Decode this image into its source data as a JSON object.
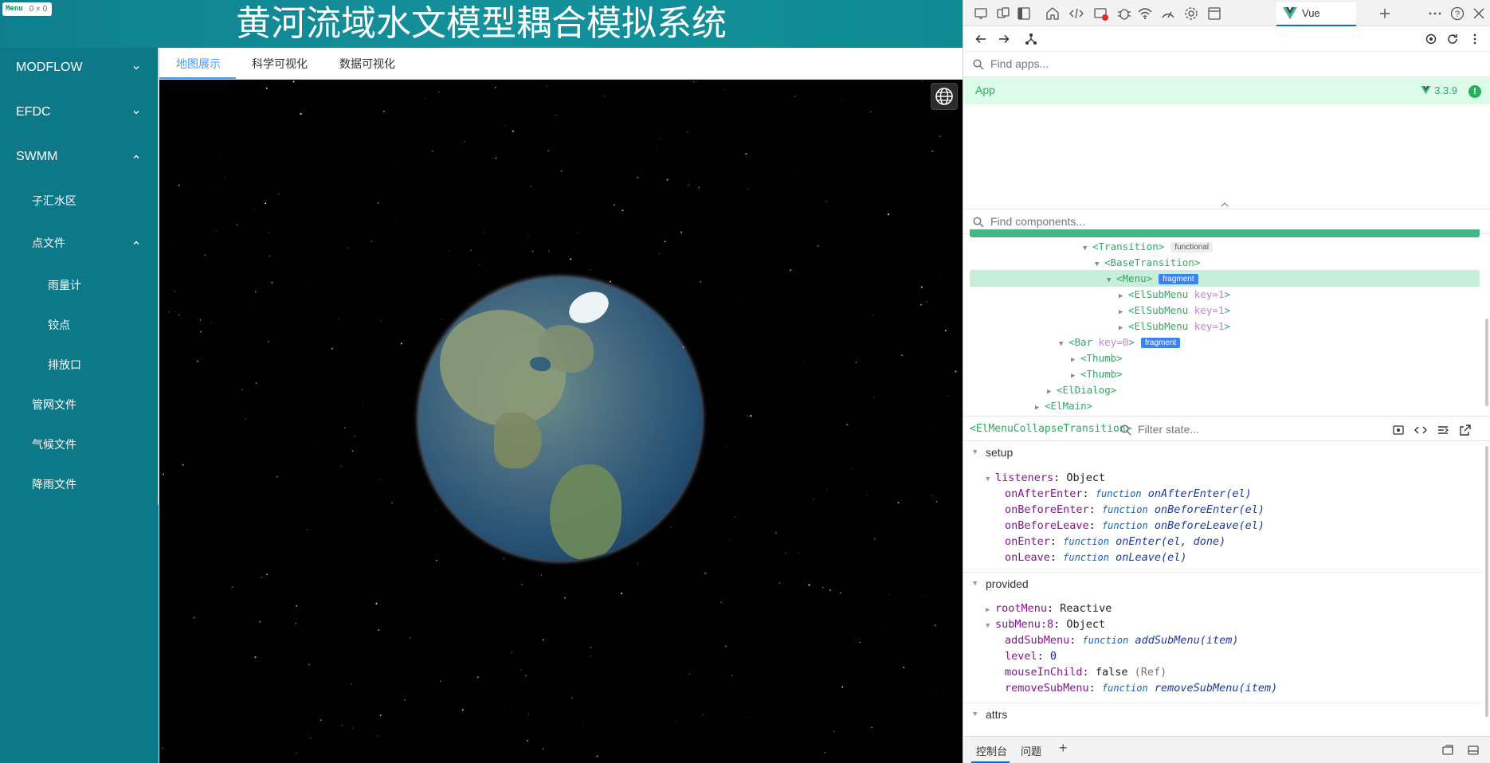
{
  "app": {
    "title": "黄河流域水文模型耦合模拟系统",
    "devtools_chip": {
      "tag": "Menu",
      "size": "0 × 0"
    },
    "sidebar": {
      "items": [
        {
          "label": "MODFLOW",
          "chevron": "down"
        },
        {
          "label": "EFDC",
          "chevron": "down"
        },
        {
          "label": "SWMM",
          "chevron": "up"
        },
        {
          "label": "子汇水区"
        },
        {
          "label": "点文件",
          "chevron": "up"
        },
        {
          "label": "雨量计"
        },
        {
          "label": "铰点"
        },
        {
          "label": "排放口"
        },
        {
          "label": "管网文件"
        },
        {
          "label": "气候文件"
        },
        {
          "label": "降雨文件"
        }
      ]
    },
    "tabs": [
      {
        "label": "地图展示",
        "active": true
      },
      {
        "label": "科学可视化",
        "active": false
      },
      {
        "label": "数据可视化",
        "active": false
      }
    ],
    "colors": {
      "header": "#14919b",
      "sidebar": "#0d7888",
      "accent": "#409eff"
    }
  },
  "devtools": {
    "toolbar_icons": [
      "screencast-icon",
      "device-emulation-icon",
      "dock-icon",
      "home-icon",
      "elements-icon",
      "network-error-icon",
      "bug-icon",
      "wifi-icon",
      "performance-icon",
      "settings-gear-icon",
      "application-icon"
    ],
    "vue_tab": {
      "label": "Vue"
    },
    "search_apps": {
      "placeholder": "Find apps..."
    },
    "app_row": {
      "name": "App",
      "version": "3.3.9"
    },
    "search_components": {
      "placeholder": "Find components..."
    },
    "tree": [
      {
        "tag": "<Transition>",
        "badge": "functional",
        "badge_type": "gray",
        "open": true
      },
      {
        "tag": "<BaseTransition>",
        "open": true
      },
      {
        "tag": "<Menu>",
        "badge": "fragment",
        "badge_type": "blue",
        "open": true,
        "selected": true
      },
      {
        "tag": "<ElSubMenu",
        "key": "key=1",
        "open": false
      },
      {
        "tag": "<ElSubMenu",
        "key": "key=1",
        "open": false
      },
      {
        "tag": "<ElSubMenu",
        "key": "key=1",
        "open": false
      },
      {
        "tag": "<Bar",
        "key": "key=0",
        "badge": "fragment",
        "badge_type": "blue",
        "open": true
      },
      {
        "tag": "<Thumb>",
        "open": false
      },
      {
        "tag": "<Thumb>",
        "open": false
      },
      {
        "tag": "<ElDialog>",
        "open": false
      },
      {
        "tag": "<ElMain>",
        "open": false
      }
    ],
    "state_header": {
      "component": "<ElMenuCollapseTransition>",
      "filter_placeholder": "Filter state..."
    },
    "state": {
      "setup": {
        "title": "setup",
        "listeners_key": "listeners",
        "listeners_type": "Object",
        "listeners": [
          {
            "key": "onAfterEnter",
            "kw": "function",
            "sig": "onAfterEnter(el)"
          },
          {
            "key": "onBeforeEnter",
            "kw": "function",
            "sig": "onBeforeEnter(el)"
          },
          {
            "key": "onBeforeLeave",
            "kw": "function",
            "sig": "onBeforeLeave(el)"
          },
          {
            "key": "onEnter",
            "kw": "function",
            "sig": "onEnter(el, done)"
          },
          {
            "key": "onLeave",
            "kw": "function",
            "sig": "onLeave(el)"
          }
        ]
      },
      "provided": {
        "title": "provided",
        "rootMenu_key": "rootMenu",
        "rootMenu_type": "Reactive",
        "subMenu_key": "subMenu:8",
        "subMenu_type": "Object",
        "subMenu": [
          {
            "key": "addSubMenu",
            "kw": "function",
            "sig": "addSubMenu(item)"
          },
          {
            "key": "level",
            "num": "0"
          },
          {
            "key": "mouseInChild",
            "val": "false",
            "muted": "(Ref)"
          },
          {
            "key": "removeSubMenu",
            "kw": "function",
            "sig": "removeSubMenu(item)"
          }
        ]
      },
      "attrs": {
        "title": "attrs"
      }
    },
    "drawer": {
      "tab1": "控制台",
      "tab2": "问题"
    }
  }
}
